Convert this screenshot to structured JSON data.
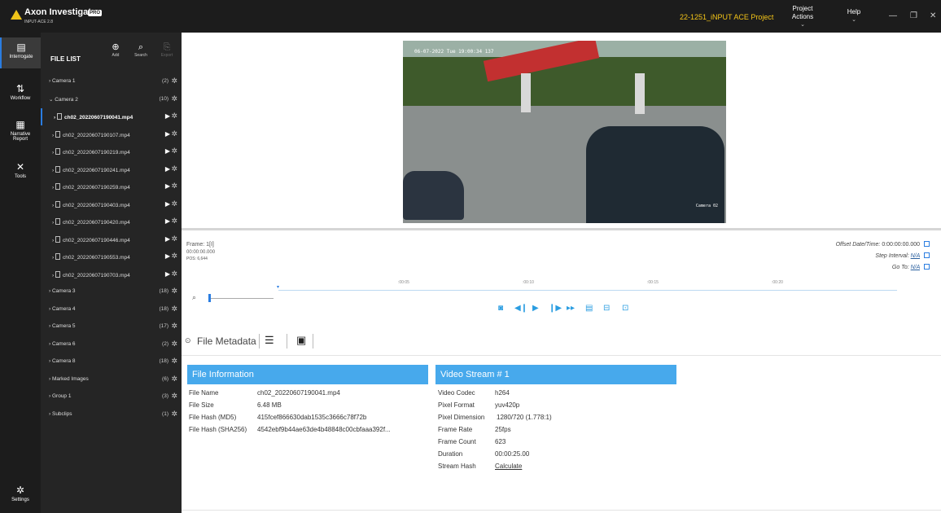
{
  "app": {
    "title": "Axon Investigate",
    "badge": "PRO",
    "version": "INPUT-ACE 2.8",
    "project": "22-1251_iNPUT ACE Project",
    "menu": [
      {
        "label": "Project\nActions",
        "chevron": "⌄"
      },
      {
        "label": "Help",
        "chevron": "⌄"
      }
    ],
    "window": {
      "minimize": "—",
      "maximize": "❐",
      "close": "✕"
    }
  },
  "rail": [
    {
      "label": "Interrogate",
      "icon": "interrogate-icon",
      "glyph": "▤"
    },
    {
      "label": "Workflow",
      "icon": "workflow-icon",
      "glyph": "⇅"
    },
    {
      "label": "Narrative Report",
      "icon": "report-icon",
      "glyph": "▦"
    },
    {
      "label": "Tools",
      "icon": "tools-icon",
      "glyph": "✕"
    },
    {
      "label": "Settings",
      "icon": "gear-icon",
      "glyph": "✲"
    }
  ],
  "filelist": {
    "title": "FILE LIST",
    "add": "Add",
    "search": "Search",
    "export": "Export",
    "rows": [
      {
        "label": "Camera 1",
        "count": "(2)",
        "type": "group",
        "expanded": false
      },
      {
        "label": "Camera 2",
        "count": "(10)",
        "type": "group",
        "expanded": true
      },
      {
        "label": "ch02_20220607190041.mp4",
        "type": "file",
        "selected": true
      },
      {
        "label": "ch02_20220607190107.mp4",
        "type": "file"
      },
      {
        "label": "ch02_20220607190219.mp4",
        "type": "file"
      },
      {
        "label": "ch02_20220607190241.mp4",
        "type": "file"
      },
      {
        "label": "ch02_20220607190259.mp4",
        "type": "file"
      },
      {
        "label": "ch02_20220607190403.mp4",
        "type": "file"
      },
      {
        "label": "ch02_20220607190420.mp4",
        "type": "file"
      },
      {
        "label": "ch02_20220607190446.mp4",
        "type": "file"
      },
      {
        "label": "ch02_20220607190553.mp4",
        "type": "file"
      },
      {
        "label": "ch02_20220607190703.mp4",
        "type": "file"
      },
      {
        "label": "Camera 3",
        "count": "(18)",
        "type": "group"
      },
      {
        "label": "Camera 4",
        "count": "(18)",
        "type": "group"
      },
      {
        "label": "Camera 5",
        "count": "(17)",
        "type": "group"
      },
      {
        "label": "Camera 6",
        "count": "(2)",
        "type": "group"
      },
      {
        "label": "Camera 8",
        "count": "(18)",
        "type": "group"
      },
      {
        "label": "Marked Images",
        "count": "(6)",
        "type": "group"
      },
      {
        "label": "Group 1",
        "count": "(3)",
        "type": "group"
      },
      {
        "label": "Subclips",
        "count": "(1)",
        "type": "group"
      }
    ]
  },
  "video": {
    "timestamp": "06-07-2022  Tue 19:00:34 137",
    "camera": "Camera 02"
  },
  "frame": {
    "frame": "Frame: 1[I]",
    "time": "00:00:00.000",
    "pos": "POS: 6,644"
  },
  "right_info": {
    "offset_label": "Offset Date/Time:",
    "offset_value": "0:00:00:00.000",
    "step_label": "Step Interval:",
    "step_value": "N/A",
    "goto_label": "Go To:",
    "goto_value": "N/A"
  },
  "timeline": {
    "ticks": [
      ":00:05",
      ":00:10",
      ":00:15",
      ":00:20"
    ],
    "duration_s": 25,
    "position_s": 0
  },
  "playback": [
    {
      "name": "snapshot-icon",
      "glyph": "◙"
    },
    {
      "name": "step-back-icon",
      "glyph": "◀❙"
    },
    {
      "name": "play-icon",
      "glyph": "▶"
    },
    {
      "name": "step-forward-icon",
      "glyph": "❙▶"
    },
    {
      "name": "fast-forward-icon",
      "glyph": "▸▸"
    },
    {
      "name": "frame-list-icon",
      "glyph": "▤"
    },
    {
      "name": "export-frame-icon",
      "glyph": "⊟"
    },
    {
      "name": "fit-view-icon",
      "glyph": "⊡"
    }
  ],
  "metadata": {
    "title": "File Metadata",
    "file_info": {
      "header": "File Information",
      "rows": [
        {
          "k": "File Name",
          "v": "ch02_20220607190041.mp4"
        },
        {
          "k": "File Size",
          "v": "6.48 MB"
        },
        {
          "k": "File Hash (MD5)",
          "v": "415fcef866630dab1535c3666c78f72b"
        },
        {
          "k": "File Hash (SHA256)",
          "v": "4542ebf9b44ae63de4b48848c00cbfaaa392f..."
        }
      ]
    },
    "video_stream": {
      "header": "Video Stream # 1",
      "rows": [
        {
          "k": "Video Codec",
          "v": "h264"
        },
        {
          "k": "Pixel Format",
          "v": "yuv420p"
        },
        {
          "k": "Pixel Dimension",
          "v": "1280/720 (1.778:1)"
        },
        {
          "k": "Frame Rate",
          "v": "25fps"
        },
        {
          "k": "Frame Count",
          "v": "623"
        },
        {
          "k": "Duration",
          "v": "00:00:25.00"
        },
        {
          "k": "Stream Hash",
          "v": "Calculate"
        }
      ]
    }
  }
}
